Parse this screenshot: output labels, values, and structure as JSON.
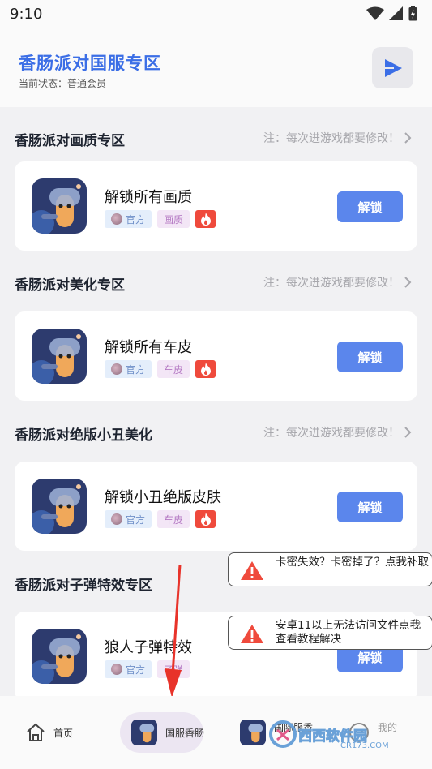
{
  "status_bar": {
    "time": "9:10",
    "icons": [
      "wifi-icon",
      "signal-icon",
      "battery-icon"
    ]
  },
  "header": {
    "title": "香肠派对国服专区",
    "status": "当前状态：普通会员",
    "action_icon": "play-icon"
  },
  "sections": [
    {
      "title": "香肠派对画质专区",
      "note": "注：每次进游戏都要修改！",
      "card": {
        "title": "解锁所有画质",
        "tag_official": "官方",
        "tag_kind": "画质",
        "button": "解锁"
      }
    },
    {
      "title": "香肠派对美化专区",
      "note": "注：每次进游戏都要修改！",
      "card": {
        "title": "解锁所有车皮",
        "tag_official": "官方",
        "tag_kind": "车皮",
        "button": "解锁"
      }
    },
    {
      "title": "香肠派对绝版小丑美化",
      "note": "注：每次进游戏都要修改！",
      "card": {
        "title": "解锁小丑绝版皮肤",
        "tag_official": "官方",
        "tag_kind": "车皮",
        "button": "解锁"
      }
    },
    {
      "title": "香肠派对子弹特效专区",
      "note": "",
      "card": {
        "title": "狼人子弹特效",
        "tag_official": "官方",
        "tag_kind": "子弹",
        "button": "解锁"
      }
    }
  ],
  "toasts": [
    {
      "text": "卡密失效？卡密掉了？点我补取",
      "icon": "warning-icon"
    },
    {
      "text": "安卓11以上无法访问文件点我查看教程解决",
      "icon": "warning-icon"
    }
  ],
  "bottom_nav": [
    {
      "label": "首页",
      "icon": "home-icon",
      "active": false
    },
    {
      "label": "国服香肠",
      "icon": "game-icon",
      "active": true
    },
    {
      "label": "国际服香",
      "icon": "game-icon",
      "active": false
    },
    {
      "label": "我的",
      "icon": "profile-icon",
      "active": false
    }
  ],
  "watermark": {
    "text": "西西软件园",
    "sub": "CR173.COM"
  },
  "colors": {
    "accent": "#3b6ee6",
    "button": "#5b86ec",
    "fire": "#ef4a3c",
    "background": "#f1f1f3"
  }
}
